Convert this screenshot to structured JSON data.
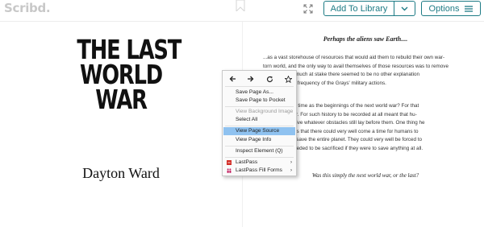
{
  "header": {
    "logo": "Scribd.",
    "add_library_label": "Add To Library",
    "options_label": "Options"
  },
  "cover": {
    "title_lines": [
      "THE LAST",
      "WORLD",
      "WAR"
    ],
    "author": "Dayton Ward"
  },
  "page": {
    "heading": "Perhaps the aliens saw Earth....",
    "para1_lines": [
      "...as a vast storehouse of resources that would aid them to rebuild their own war-",
      "torn world, and the only way to avail themselves of those resources was to remove",
      "t. With so much at stake there seemed to be no other explanation",
      "trocity and frequency of the Grays' military actions."
    ],
    "para2_lines": [
      "egard this time as the beginnings of the next world war? For that",
      "no answer. For such history to be recorded at all meant that hu-",
      "ve to survive whatever obstacles still lay before them. One thing he",
      "pared, was that there could very well come a time for humans to",
      "could not save the entire planet. They could very well be forced to",
      "rts of it needed to be sacrificed if they were to save anything at all."
    ],
    "closing": "Was this simply the next world war, or the last?"
  },
  "context_menu": {
    "items": [
      {
        "label": "Save Page As...",
        "disabled": false,
        "highlight": false
      },
      {
        "label": "Save Page to Pocket",
        "disabled": false,
        "highlight": false
      },
      {
        "label": "View Background Image",
        "disabled": true,
        "highlight": false
      },
      {
        "label": "Select All",
        "disabled": false,
        "highlight": false
      },
      {
        "label": "View Page Source",
        "disabled": false,
        "highlight": true
      },
      {
        "label": "View Page Info",
        "disabled": false,
        "highlight": false
      },
      {
        "label": "Inspect Element (Q)",
        "disabled": false,
        "highlight": false
      },
      {
        "label": "LastPass",
        "disabled": false,
        "highlight": false
      },
      {
        "label": "LastPass Fill Forms",
        "disabled": false,
        "highlight": false
      }
    ]
  },
  "colors": {
    "accent": "#1e7b85",
    "menu_highlight": "#8fc2f0",
    "lastpass": "#d32d27",
    "fillforms": "#c2185b"
  },
  "icons": {
    "toolbar": [
      "bookmark-icon",
      "expand-icon",
      "chevron-down-icon",
      "hamburger-icon"
    ],
    "menu_nav": [
      "back-arrow-icon",
      "forward-arrow-icon",
      "reload-icon",
      "star-icon"
    ],
    "submenu": "chevron-right-icon"
  }
}
